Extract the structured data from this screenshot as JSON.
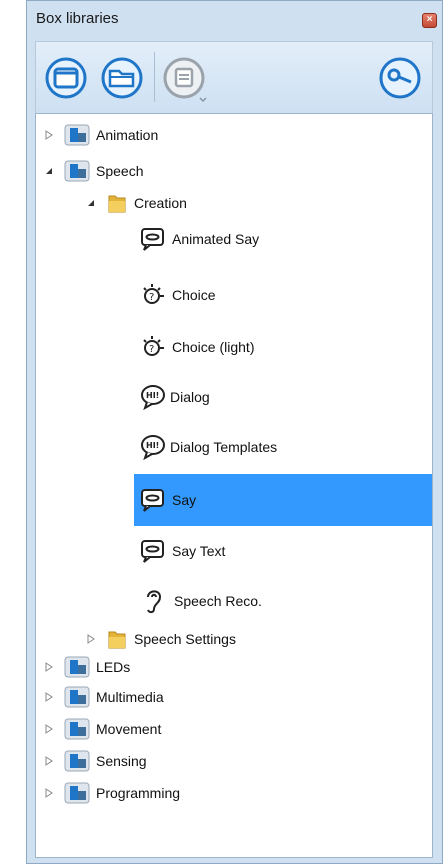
{
  "window": {
    "title": "Box libraries"
  },
  "toolbar": {
    "buttons": [
      {
        "name": "new-library-button",
        "icon": "window-icon"
      },
      {
        "name": "open-library-button",
        "icon": "folder-icon"
      },
      {
        "name": "box-properties-button",
        "icon": "box-dropdown-icon"
      },
      {
        "name": "search-button",
        "icon": "search-icon"
      }
    ]
  },
  "tree": {
    "animation": "Animation",
    "speech": "Speech",
    "creation": "Creation",
    "animated_say": "Animated Say",
    "choice": "Choice",
    "choice_light": "Choice (light)",
    "dialog": "Dialog",
    "dialog_templates": "Dialog Templates",
    "say": "Say",
    "say_text": "Say Text",
    "speech_reco": "Speech Reco.",
    "speech_settings": "Speech Settings",
    "leds": "LEDs",
    "multimedia": "Multimedia",
    "movement": "Movement",
    "sensing": "Sensing",
    "programming": "Programming"
  },
  "colors": {
    "accent": "#3399ff",
    "frame": "#cfe0f1",
    "icon_blue": "#1f76c9"
  }
}
